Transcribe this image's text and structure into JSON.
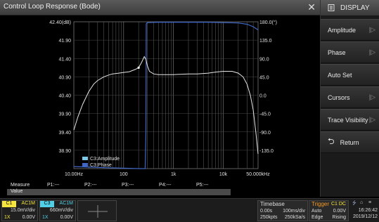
{
  "window": {
    "title": "Control Loop Response (Bode)"
  },
  "sidemenu": {
    "header": "DISPLAY",
    "items": [
      {
        "label": "Amplitude",
        "has_sub": true
      },
      {
        "label": "Phase",
        "has_sub": true
      },
      {
        "label": "Auto Set",
        "has_sub": false
      },
      {
        "label": "Cursors",
        "has_sub": true
      },
      {
        "label": "Trace Visibility",
        "has_sub": true
      },
      {
        "label": "Return",
        "has_sub": false
      }
    ]
  },
  "chart_data": {
    "type": "line",
    "x_scale": "log",
    "x_ticks": [
      "10.00Hz",
      "100",
      "1k",
      "10k",
      "50.000kHz"
    ],
    "y_left_ticks": [
      "42.40(dB)",
      "41.90",
      "41.40",
      "40.90",
      "40.40",
      "39.90",
      "39.40",
      "38.90"
    ],
    "y_right_ticks": [
      "180.0(°)",
      "135.0",
      "90.0",
      "45.0",
      "0.0",
      "-45.0",
      "-90.0",
      "-135.0"
    ],
    "ylim_amplitude": [
      38.4,
      42.4
    ],
    "ylim_phase": [
      -180,
      180
    ],
    "legend": {
      "placement": "bottom-left",
      "entries": [
        "C3:Amplitude",
        "C3:Phase"
      ]
    },
    "series": [
      {
        "name": "C3:Amplitude",
        "color": "#e6e6e6",
        "x": [
          10,
          12,
          15,
          20,
          25,
          30,
          40,
          50,
          60,
          80,
          100,
          130,
          170,
          200,
          230,
          260,
          280,
          300,
          330,
          400,
          500,
          700,
          1000,
          2000,
          3000,
          5000,
          7000,
          10000,
          15000,
          20000,
          25000,
          30000,
          35000,
          40000,
          45000,
          50000
        ],
        "y": [
          39.45,
          39.8,
          40.15,
          40.5,
          40.7,
          40.8,
          40.9,
          40.95,
          40.98,
          41.0,
          41.02,
          41.04,
          41.1,
          41.15,
          41.3,
          41.45,
          41.38,
          41.2,
          41.05,
          40.98,
          40.96,
          40.96,
          40.96,
          40.98,
          40.98,
          41.0,
          41.03,
          41.05,
          41.05,
          41.0,
          40.9,
          40.7,
          40.4,
          40.0,
          39.4,
          38.8
        ]
      },
      {
        "name": "C3:Phase",
        "color": "#3f67c8",
        "x": [
          10,
          50,
          100,
          150,
          200,
          250,
          270,
          280,
          285,
          300,
          500,
          1000,
          5000,
          10000,
          20000,
          30000,
          40000,
          50000
        ],
        "y": [
          -175,
          -178,
          -179,
          -179.5,
          -180,
          -180,
          -180,
          -90,
          175,
          178,
          179,
          179,
          179,
          178,
          177,
          174,
          168,
          160
        ]
      }
    ],
    "marker": {
      "x": 200,
      "y": 41.15
    }
  },
  "measure": {
    "label": "Measure",
    "value_label": "Value",
    "items": [
      "P1:---",
      "P2:---",
      "P3:---",
      "P4:---",
      "P5:---"
    ]
  },
  "channels": [
    {
      "id": "C1",
      "coupling": "AC1M",
      "vdiv": "15.0mV/div",
      "probe": "1X",
      "offset": "0.00V",
      "color": "#f6e53c"
    },
    {
      "id": "C3",
      "coupling": "AC1M",
      "vdiv": "660mV/div",
      "probe": "1X",
      "offset": "0.00V",
      "color": "#50d0e8"
    }
  ],
  "timebase": {
    "label": "Timebase",
    "delay": "0.00s",
    "scale": "100ms/div",
    "sample_points": "250kpts",
    "sample_rate": "250kSa/s"
  },
  "trigger": {
    "label": "Trigger",
    "source": "C1 DC",
    "mode": "Auto",
    "level": "0.00V",
    "type": "Edge",
    "slope": "Rising"
  },
  "status": {
    "time": "16:26:42",
    "date": "2019/12/12"
  }
}
